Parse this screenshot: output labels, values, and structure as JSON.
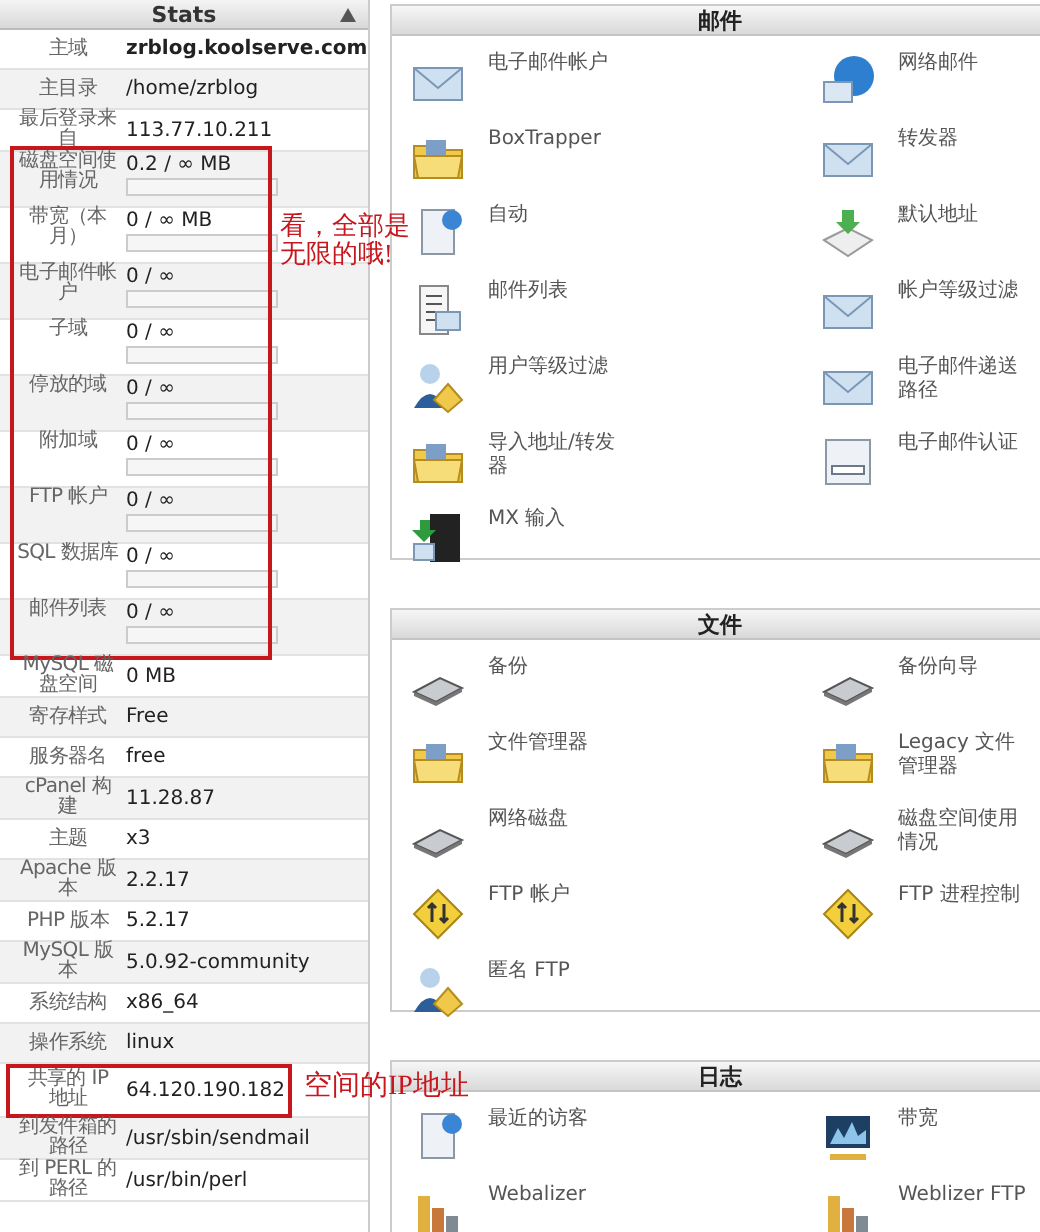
{
  "stats": {
    "title": "Stats",
    "rows": [
      {
        "label": "主域",
        "value": "zrblog.koolserve.com",
        "kind": "text",
        "bold": true
      },
      {
        "label": "主目录",
        "value": "/home/zrblog",
        "kind": "text"
      },
      {
        "label": "最后登录来自",
        "value": "113.77.10.211",
        "kind": "text"
      },
      {
        "label": "磁盘空间使用情况",
        "value": "0.2 / ∞ MB",
        "kind": "meter",
        "level": 0
      },
      {
        "label": "带宽（本月）",
        "value": "0 / ∞ MB",
        "kind": "meter",
        "level": 0
      },
      {
        "label": "电子邮件帐户",
        "value": "0 / ∞",
        "kind": "meter",
        "level": 0
      },
      {
        "label": "子域",
        "value": "0 / ∞",
        "kind": "meter",
        "level": 0
      },
      {
        "label": "停放的域",
        "value": "0 / ∞",
        "kind": "meter",
        "level": 0
      },
      {
        "label": "附加域",
        "value": "0 / ∞",
        "kind": "meter",
        "level": 0
      },
      {
        "label": "FTP 帐户",
        "value": "0 / ∞",
        "kind": "meter",
        "level": 0
      },
      {
        "label": "SQL 数据库",
        "value": "0 / ∞",
        "kind": "meter",
        "level": 0
      },
      {
        "label": "邮件列表",
        "value": "0 / ∞",
        "kind": "meter",
        "level": 0
      },
      {
        "label": "MySQL 磁盘空间",
        "value": "0 MB",
        "kind": "text"
      },
      {
        "label": "寄存样式",
        "value": "Free",
        "kind": "text"
      },
      {
        "label": "服务器名",
        "value": "free",
        "kind": "text"
      },
      {
        "label": "cPanel 构建",
        "value": "11.28.87",
        "kind": "text"
      },
      {
        "label": "主题",
        "value": "x3",
        "kind": "text"
      },
      {
        "label": "Apache 版本",
        "value": "2.2.17",
        "kind": "text"
      },
      {
        "label": "PHP 版本",
        "value": "5.2.17",
        "kind": "text"
      },
      {
        "label": "MySQL 版本",
        "value": "5.0.92-community",
        "kind": "text"
      },
      {
        "label": "系统结构",
        "value": "x86_64",
        "kind": "text"
      },
      {
        "label": "操作系统",
        "value": "linux",
        "kind": "text"
      },
      {
        "label": "共享的 IP 地址",
        "value": "64.120.190.182",
        "kind": "text"
      },
      {
        "label": "到发件箱的路径",
        "value": "/usr/sbin/sendmail",
        "kind": "text"
      },
      {
        "label": "到 PERL 的路径",
        "value": "/usr/bin/perl",
        "kind": "text"
      }
    ]
  },
  "sections": [
    {
      "title": "邮件",
      "items": [
        {
          "label": "电子邮件帐户"
        },
        {
          "label": "网络邮件"
        },
        {
          "label": "BoxTrapper"
        },
        {
          "label": "转发器"
        },
        {
          "label": "自动"
        },
        {
          "label": "默认地址"
        },
        {
          "label": "邮件列表"
        },
        {
          "label": "帐户等级过滤"
        },
        {
          "label": "用户等级过滤"
        },
        {
          "label": "电子邮件递送路径"
        },
        {
          "label": "导入地址/转发器"
        },
        {
          "label": "电子邮件认证"
        },
        {
          "label": "MX 输入"
        }
      ]
    },
    {
      "title": "文件",
      "items": [
        {
          "label": "备份"
        },
        {
          "label": "备份向导"
        },
        {
          "label": "文件管理器"
        },
        {
          "label": "Legacy 文件管理器"
        },
        {
          "label": "网络磁盘"
        },
        {
          "label": "磁盘空间使用情况"
        },
        {
          "label": "FTP 帐户"
        },
        {
          "label": "FTP 进程控制"
        },
        {
          "label": "匿名 FTP"
        }
      ]
    },
    {
      "title": "日志",
      "items": [
        {
          "label": "最近的访客"
        },
        {
          "label": "带宽"
        },
        {
          "label": "Webalizer"
        },
        {
          "label": "Weblizer FTP"
        }
      ]
    }
  ],
  "annotations": [
    {
      "text": "看，全部是无限的哦!"
    },
    {
      "text": "空间的IP地址"
    }
  ]
}
